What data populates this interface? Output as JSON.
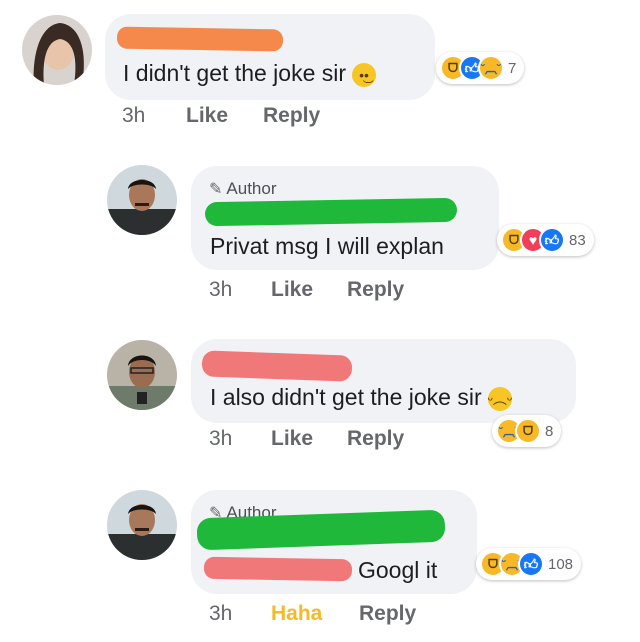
{
  "comments": [
    {
      "is_author": false,
      "text": "I didn't get the joke sir",
      "emoji": "confused",
      "time": "3h",
      "like_label": "Like",
      "reply_label": "Reply",
      "reaction_count": "7",
      "reactions": [
        "haha-icon",
        "like-icon",
        "sad-icon"
      ]
    },
    {
      "is_author": true,
      "author_label": "Author",
      "text": "Privat msg I will explan",
      "time": "3h",
      "like_label": "Like",
      "reply_label": "Reply",
      "reaction_count": "83",
      "reactions": [
        "haha-icon",
        "love-icon",
        "like-icon"
      ]
    },
    {
      "is_author": false,
      "text": "I also didn't get the joke sir",
      "emoji": "pensive",
      "time": "3h",
      "like_label": "Like",
      "reply_label": "Reply",
      "reaction_count": "8",
      "reactions": [
        "sad-icon",
        "haha-icon"
      ]
    },
    {
      "is_author": true,
      "author_label": "Author",
      "text": "Googl it",
      "time": "3h",
      "like_label": "Haha",
      "like_active": true,
      "reply_label": "Reply",
      "reaction_count": "108",
      "reactions": [
        "haha-icon",
        "sad-icon",
        "like-icon"
      ]
    }
  ],
  "colors": {
    "bubble": "#f0f2f5",
    "redact_orange": "#f4894b",
    "redact_green": "#1fb83a",
    "redact_pink": "#f07878",
    "haha_active": "#f7b928",
    "like_blue": "#1877f2"
  }
}
